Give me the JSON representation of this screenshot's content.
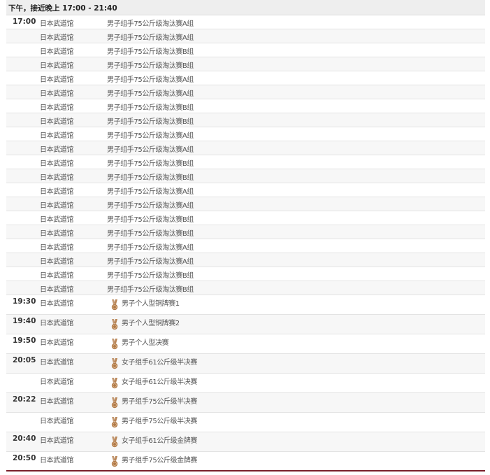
{
  "colors": {
    "header_bg": "#eeeeee",
    "alt_row_bg": "#f7f7f7",
    "bottom_rule": "#7a1f2b",
    "medal": "#b07845"
  },
  "schedule": {
    "period_label": "下午，接近晚上  17:00 - 21:40",
    "rows": [
      {
        "time": "17:00",
        "venue": "日本武道馆",
        "event": "男子组手75公斤级淘汰赛A组",
        "medal": false
      },
      {
        "time": "",
        "venue": "日本武道馆",
        "event": "男子组手75公斤级淘汰赛A组",
        "medal": false
      },
      {
        "time": "",
        "venue": "日本武道馆",
        "event": "男子组手75公斤级淘汰赛B组",
        "medal": false
      },
      {
        "time": "",
        "venue": "日本武道馆",
        "event": "男子组手75公斤级淘汰赛B组",
        "medal": false
      },
      {
        "time": "",
        "venue": "日本武道馆",
        "event": "男子组手75公斤级淘汰赛A组",
        "medal": false
      },
      {
        "time": "",
        "venue": "日本武道馆",
        "event": "男子组手75公斤级淘汰赛A组",
        "medal": false
      },
      {
        "time": "",
        "venue": "日本武道馆",
        "event": "男子组手75公斤级淘汰赛B组",
        "medal": false
      },
      {
        "time": "",
        "venue": "日本武道馆",
        "event": "男子组手75公斤级淘汰赛B组",
        "medal": false
      },
      {
        "time": "",
        "venue": "日本武道馆",
        "event": "男子组手75公斤级淘汰赛A组",
        "medal": false
      },
      {
        "time": "",
        "venue": "日本武道馆",
        "event": "男子组手75公斤级淘汰赛A组",
        "medal": false
      },
      {
        "time": "",
        "venue": "日本武道馆",
        "event": "男子组手75公斤级淘汰赛B组",
        "medal": false
      },
      {
        "time": "",
        "venue": "日本武道馆",
        "event": "男子组手75公斤级淘汰赛B组",
        "medal": false
      },
      {
        "time": "",
        "venue": "日本武道馆",
        "event": "男子组手75公斤级淘汰赛A组",
        "medal": false
      },
      {
        "time": "",
        "venue": "日本武道馆",
        "event": "男子组手75公斤级淘汰赛A组",
        "medal": false
      },
      {
        "time": "",
        "venue": "日本武道馆",
        "event": "男子组手75公斤级淘汰赛B组",
        "medal": false
      },
      {
        "time": "",
        "venue": "日本武道馆",
        "event": "男子组手75公斤级淘汰赛B组",
        "medal": false
      },
      {
        "time": "",
        "venue": "日本武道馆",
        "event": "男子组手75公斤级淘汰赛A组",
        "medal": false
      },
      {
        "time": "",
        "venue": "日本武道馆",
        "event": "男子组手75公斤级淘汰赛A组",
        "medal": false
      },
      {
        "time": "",
        "venue": "日本武道馆",
        "event": "男子组手75公斤级淘汰赛B组",
        "medal": false
      },
      {
        "time": "",
        "venue": "日本武道馆",
        "event": "男子组手75公斤级淘汰赛B组",
        "medal": false
      },
      {
        "time": "19:30",
        "venue": "日本武道馆",
        "event": "男子个人型铜牌赛1",
        "medal": true
      },
      {
        "time": "19:40",
        "venue": "日本武道馆",
        "event": "男子个人型铜牌赛2",
        "medal": true
      },
      {
        "time": "19:50",
        "venue": "日本武道馆",
        "event": "男子个人型决赛",
        "medal": true
      },
      {
        "time": "20:05",
        "venue": "日本武道馆",
        "event": "女子组手61公斤级半决赛",
        "medal": true
      },
      {
        "time": "",
        "venue": "日本武道馆",
        "event": "女子组手61公斤级半决赛",
        "medal": true
      },
      {
        "time": "20:22",
        "venue": "日本武道馆",
        "event": "男子组手75公斤级半决赛",
        "medal": true
      },
      {
        "time": "",
        "venue": "日本武道馆",
        "event": "男子组手75公斤级半决赛",
        "medal": true
      },
      {
        "time": "20:40",
        "venue": "日本武道馆",
        "event": "女子组手61公斤级金牌赛",
        "medal": true
      },
      {
        "time": "20:50",
        "venue": "日本武道馆",
        "event": "男子组手75公斤级金牌赛",
        "medal": true
      }
    ]
  }
}
